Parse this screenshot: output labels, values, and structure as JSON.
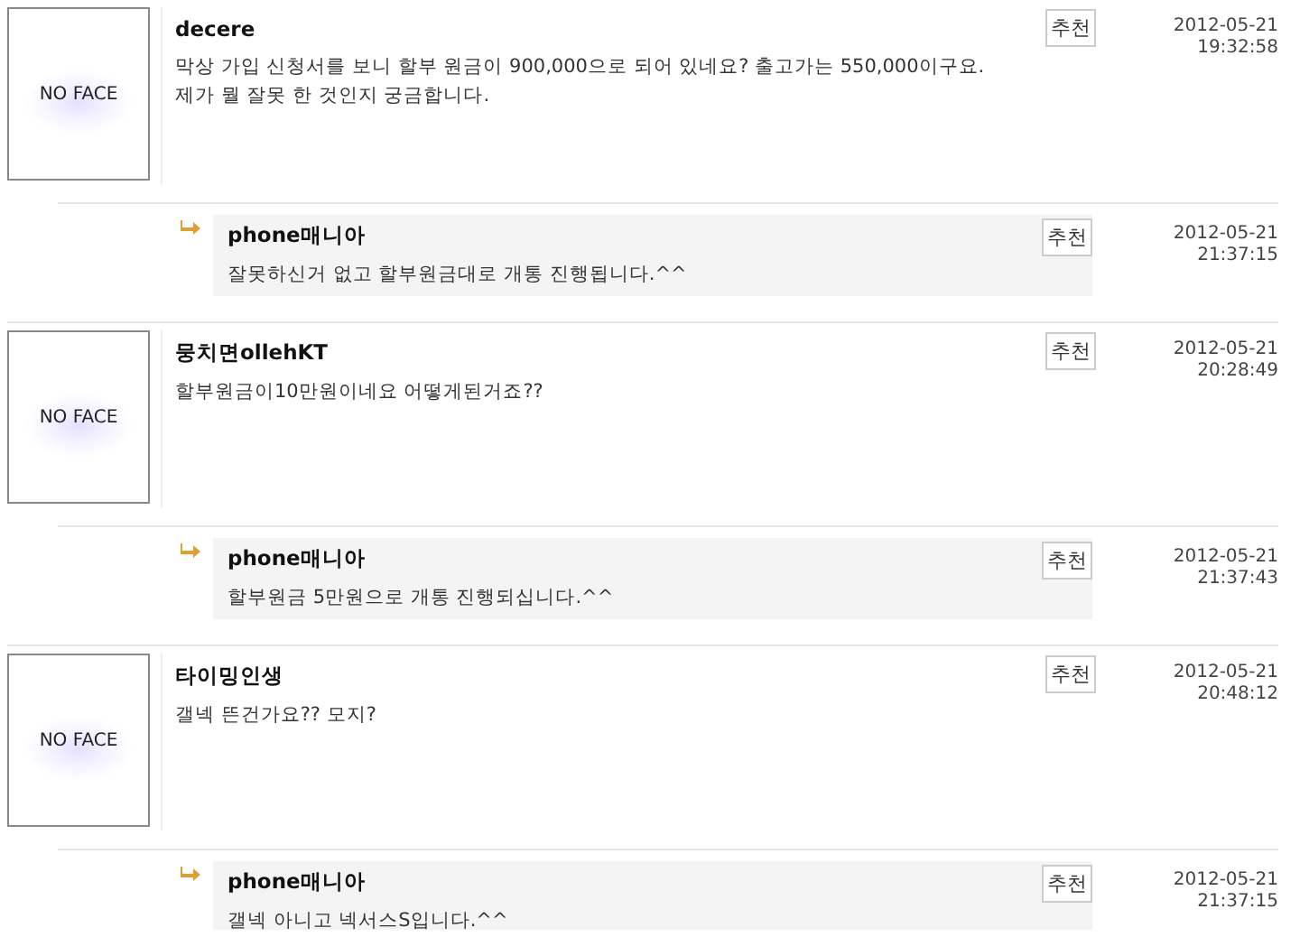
{
  "comments": [
    {
      "avatar_text": "NO FACE",
      "author": "decere",
      "lines": [
        "막상 가입 신청서를 보니 할부 원금이 900,000으로 되어 있네요? 출고가는 550,000이구요.",
        "제가 뭘 잘못 한 것인지 궁금합니다."
      ],
      "button": "추천",
      "date": "2012-05-21",
      "time": "19:32:58",
      "replies": [
        {
          "author": "phone매니아",
          "lines": [
            "잘못하신거 없고 할부원금대로 개통 진행됩니다.^^"
          ],
          "button": "추천",
          "date": "2012-05-21",
          "time": "21:37:15"
        }
      ]
    },
    {
      "avatar_text": "NO FACE",
      "author": "뭉치면ollehKT",
      "lines": [
        "할부원금이10만원이네요 어떻게된거죠??"
      ],
      "button": "추천",
      "date": "2012-05-21",
      "time": "20:28:49",
      "replies": [
        {
          "author": "phone매니아",
          "lines": [
            "할부원금 5만원으로 개통 진행되십니다.^^"
          ],
          "button": "추천",
          "date": "2012-05-21",
          "time": "21:37:43"
        }
      ]
    },
    {
      "avatar_text": "NO FACE",
      "author": "타이밍인생",
      "lines": [
        "갤넥 뜬건가요?? 모지?"
      ],
      "button": "추천",
      "date": "2012-05-21",
      "time": "20:48:12",
      "replies": [
        {
          "author": "phone매니아",
          "lines": [
            "갤넥 아니고 넥서스S입니다.^^"
          ],
          "button": "추천",
          "date": "2012-05-21",
          "time": "21:37:15"
        }
      ]
    }
  ]
}
